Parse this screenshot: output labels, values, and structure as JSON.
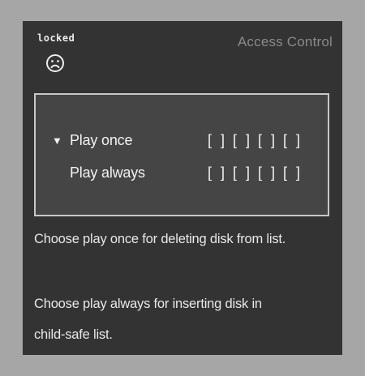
{
  "status": {
    "label": "locked",
    "icon": "sad-face-icon"
  },
  "header": {
    "title": "Access Control"
  },
  "options": [
    {
      "label": "Play once",
      "selected_marker": "▼",
      "slots": [
        "[ ]",
        "[ ]",
        "[ ]",
        "[ ]"
      ]
    },
    {
      "label": "Play always",
      "selected_marker": "",
      "slots": [
        "[ ]",
        "[ ]",
        "[ ]",
        "[ ]"
      ]
    }
  ],
  "help": {
    "line1": "Choose play once for deleting  disk from list.",
    "line2": "Choose play always for inserting disk in",
    "line3": "child-safe list."
  },
  "colors": {
    "background": "#a6a6a6",
    "panel": "#333333",
    "box": "#454545",
    "box_border": "#c8c8c8",
    "title": "#8a8a8a",
    "text": "#f2f2f2"
  }
}
